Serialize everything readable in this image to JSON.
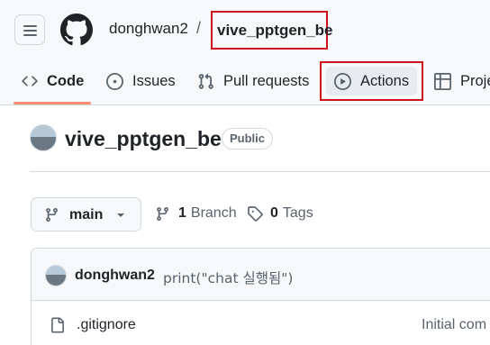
{
  "header": {
    "owner": "donghwan2",
    "separator": "/",
    "repo": "vive_pptgen_be"
  },
  "tabs": [
    {
      "label": "Code",
      "icon": "code-icon"
    },
    {
      "label": "Issues",
      "icon": "issue-opened-icon"
    },
    {
      "label": "Pull requests",
      "icon": "git-pull-request-icon"
    },
    {
      "label": "Actions",
      "icon": "play-icon"
    },
    {
      "label": "Proje",
      "icon": "table-icon"
    }
  ],
  "repo": {
    "title": "vive_pptgen_be",
    "visibility": "Public"
  },
  "branch_bar": {
    "current_branch": "main",
    "branch_count": "1",
    "branch_label": "Branch",
    "tag_count": "0",
    "tag_label": "Tags"
  },
  "latest_commit": {
    "author": "donghwan2",
    "message": "print(\"chat 실행됨\")"
  },
  "files": [
    {
      "name": ".gitignore",
      "commit": "Initial com",
      "icon": "file-icon"
    }
  ],
  "colors": {
    "highlight_box": "#d0101a",
    "active_tab_underline": "#fd8c73",
    "header_bg": "#f6f8fa"
  }
}
